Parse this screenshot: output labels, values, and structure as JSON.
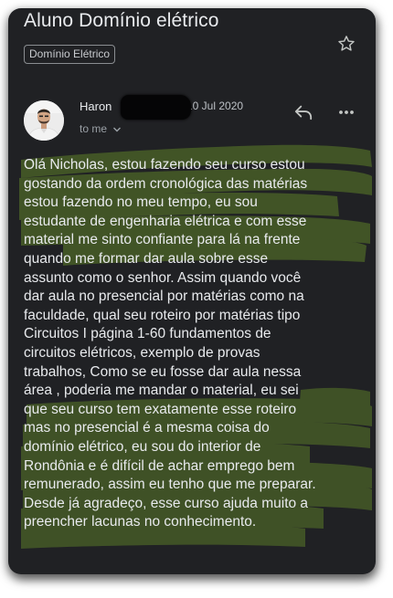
{
  "email": {
    "subject": "Aluno Domínio elétrico",
    "label": "Domínio Elétrico",
    "sender_name": "Haron",
    "date": "10 Jul 2020",
    "recipient": "to me",
    "body": "Olá Nicholas, estou fazendo seu curso estou\ngostando da ordem cronológica das matérias\nestou fazendo no meu tempo, eu  sou\nestudante de engenharia elétrica e com esse\nmaterial me sinto confiante para lá na frente\nquando me formar dar aula sobre esse\nassunto como o senhor. Assim quando  você\ndar aula no presencial por matérias como na\nfaculdade, qual seu roteiro por matérias tipo\nCircuitos I página 1-60 fundamentos de\ncircuitos elétricos, exemplo de provas\ntrabalhos, Como se eu fosse dar aula nessa\nárea , poderia me mandar o material, eu sei\nque seu curso tem exatamente esse roteiro\nmas no presencial é a mesma coisa do\ndomínio elétrico, eu sou do interior de\nRondônia e é difícil de achar emprego bem\nremunerado, assim eu tenho que me preparar.\nDesde já agradeço, esse curso ajuda muito a\npreencher lacunas no conhecimento."
  },
  "icons": {
    "star": "star-outline-icon",
    "reply": "reply-icon",
    "more": "more-vert-icon",
    "chevron": "chevron-down-icon"
  },
  "colors": {
    "background": "#202124",
    "text": "#e8eaed",
    "secondary_text": "#9aa0a6",
    "highlight": "#6f9a2a"
  }
}
